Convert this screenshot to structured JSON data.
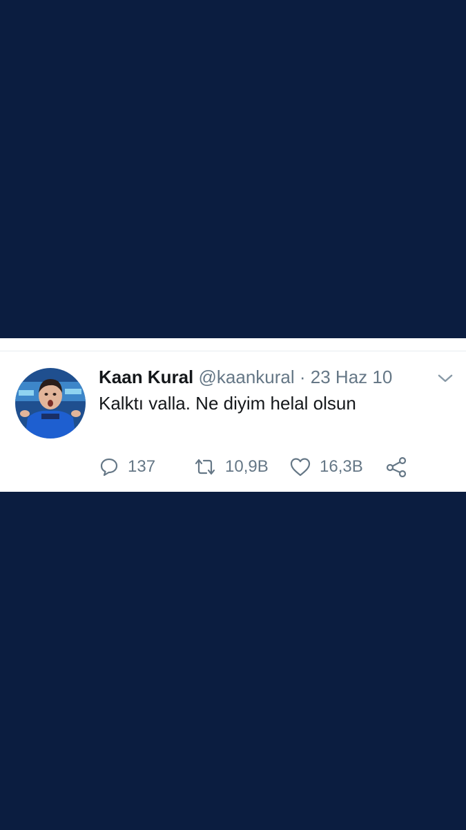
{
  "tweet": {
    "display_name": "Kaan Kural",
    "handle": "@kaankural",
    "separator": "·",
    "date": "23 Haz 10",
    "text": "Kalktı valla. Ne diyim helal olsun",
    "avatar_icon": "profile-photo-icon",
    "more_icon": "chevron-down-icon",
    "actions": {
      "reply": {
        "icon": "reply-icon",
        "count": "137"
      },
      "retweet": {
        "icon": "retweet-icon",
        "count": "10,9B"
      },
      "like": {
        "icon": "heart-icon",
        "count": "16,3B"
      },
      "share": {
        "icon": "share-icon"
      }
    }
  },
  "colors": {
    "background": "#0b1d40",
    "card": "#ffffff",
    "primary_text": "#14171a",
    "secondary_text": "#657786"
  }
}
